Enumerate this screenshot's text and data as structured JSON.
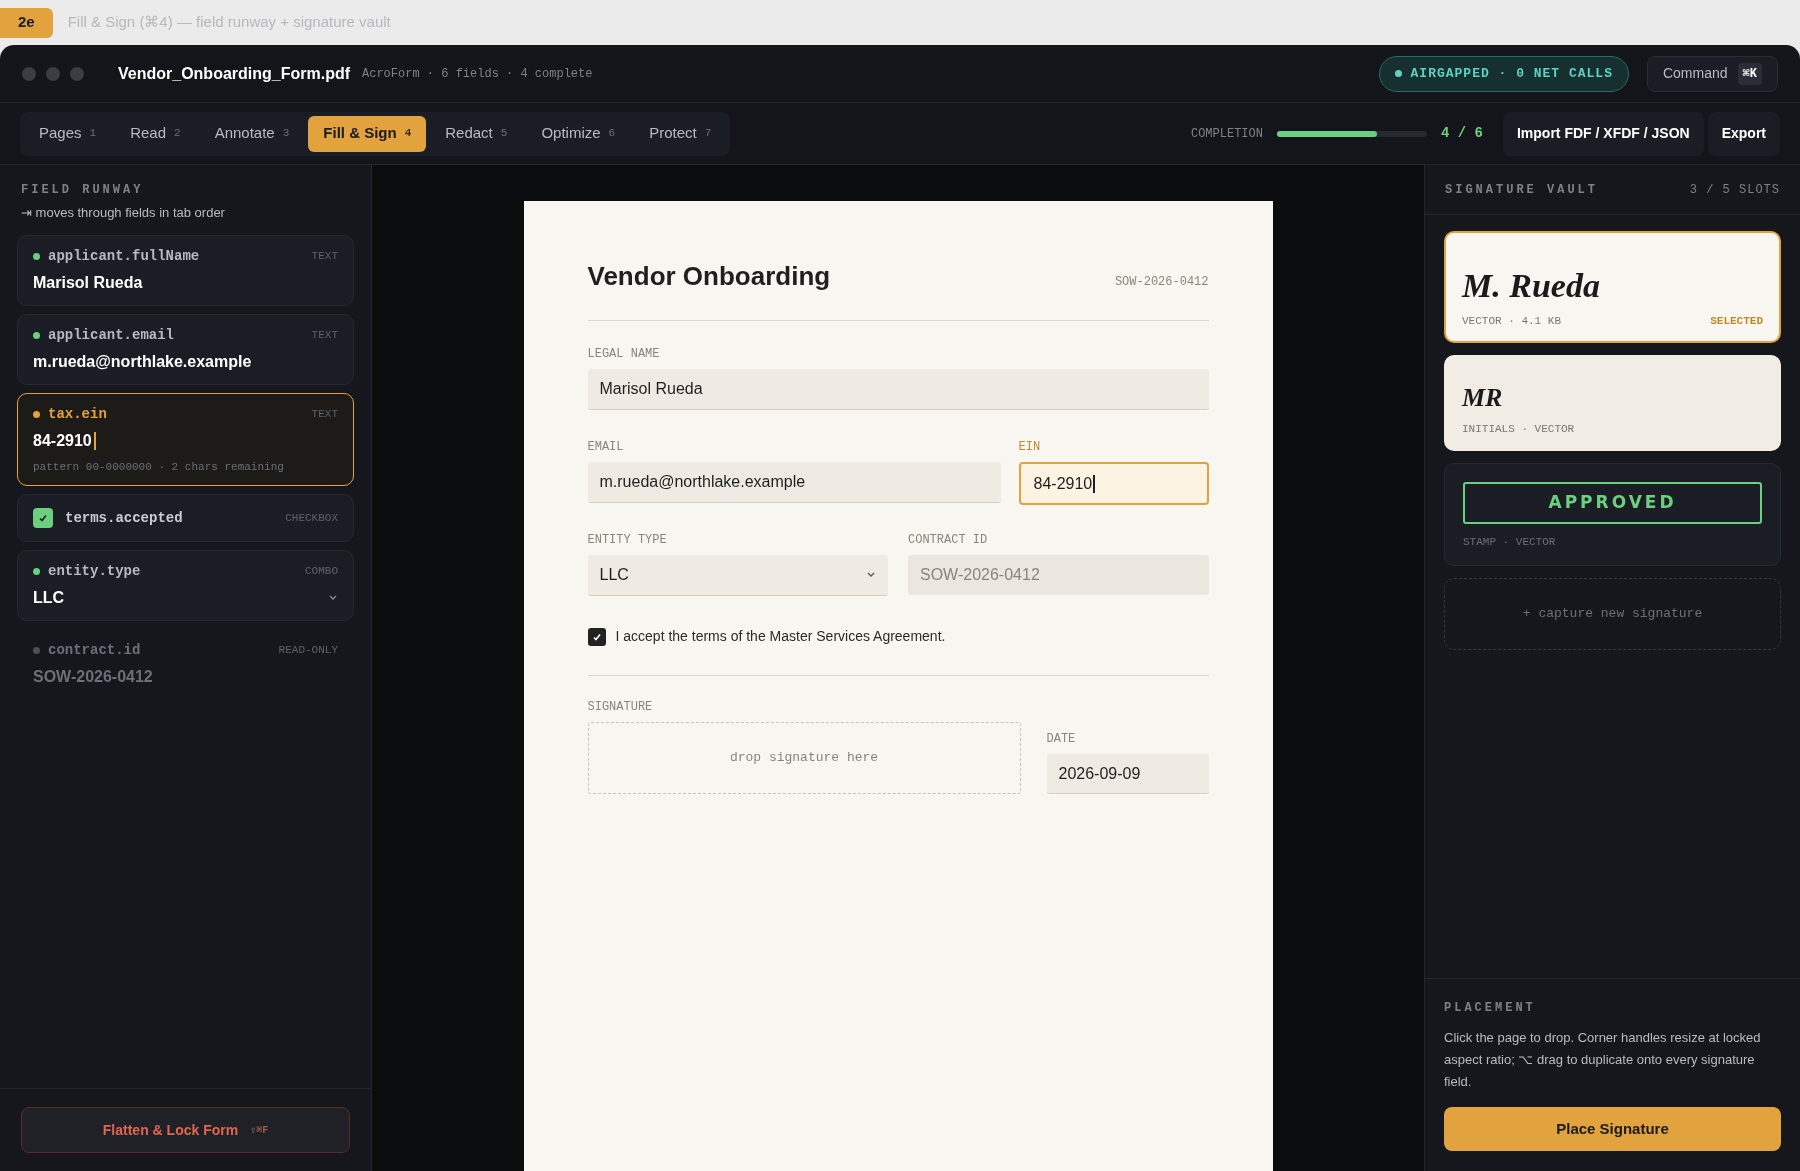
{
  "header": {
    "badge": "2e",
    "caption": "Fill & Sign (⌘4) — field runway + signature vault"
  },
  "window": {
    "filename": "Vendor_Onboarding_Form.pdf",
    "meta": "AcroForm · 6 fields · 4 complete",
    "status": "AIRGAPPED · 0 NET CALLS",
    "command": {
      "label": "Command",
      "shortcut": "⌘K"
    }
  },
  "tabs": [
    {
      "label": "Pages",
      "key": "1",
      "selected": false
    },
    {
      "label": "Read",
      "key": "2",
      "selected": false
    },
    {
      "label": "Annotate",
      "key": "3",
      "selected": false
    },
    {
      "label": "Fill & Sign",
      "key": "4",
      "selected": true
    },
    {
      "label": "Redact",
      "key": "5",
      "selected": false
    },
    {
      "label": "Optimize",
      "key": "6",
      "selected": false
    },
    {
      "label": "Protect",
      "key": "7",
      "selected": false
    }
  ],
  "completion": {
    "label": "COMPLETION",
    "level": 0.667,
    "reading": "4 / 6"
  },
  "actions": [
    "Import FDF / XFDF / JSON",
    "Export"
  ],
  "runway": {
    "title": "FIELD RUNWAY",
    "hint": "⇥ moves through fields in tab order",
    "fields": [
      {
        "kind": "text",
        "name": "applicant.fullName",
        "type": "TEXT",
        "value": "Marisol Rueda",
        "color": "#6ccf7f",
        "selected": false
      },
      {
        "kind": "text",
        "name": "applicant.email",
        "type": "TEXT",
        "value": "m.rueda@northlake.example",
        "color": "#6ccf7f",
        "selected": false
      },
      {
        "kind": "text",
        "name": "tax.ein",
        "type": "TEXT",
        "value": "84-2910",
        "color": "#e2a23e",
        "selected": true,
        "hint": "pattern 00-0000000 · 2 chars remaining"
      },
      {
        "kind": "checkbox",
        "name": "terms.accepted",
        "type": "CHECKBOX",
        "checked": true,
        "selected": false
      },
      {
        "kind": "combo",
        "name": "entity.type",
        "type": "COMBO",
        "value": "LLC",
        "color": "#6ccf7f",
        "selected": false
      },
      {
        "kind": "readonly",
        "name": "contract.id",
        "type": "READ-ONLY",
        "value": "SOW-2026-0412",
        "color": "#4b5058",
        "selected": false
      }
    ],
    "flatten": {
      "label": "Flatten & Lock Form",
      "shortcut": "⇧⌘F"
    }
  },
  "document": {
    "title": "Vendor Onboarding",
    "ref": "SOW-2026-0412",
    "legal_name": {
      "label": "LEGAL NAME",
      "value": "Marisol Rueda"
    },
    "email": {
      "label": "EMAIL",
      "value": "m.rueda@northlake.example"
    },
    "ein": {
      "label": "EIN",
      "value": "84-2910",
      "focused": true
    },
    "entity_type": {
      "label": "ENTITY TYPE",
      "value": "LLC"
    },
    "contract_id": {
      "label": "CONTRACT ID",
      "value": "SOW-2026-0412",
      "disabled": true
    },
    "terms": {
      "label": "I accept the terms of the Master Services Agreement.",
      "checked": true
    },
    "signature": {
      "label": "SIGNATURE",
      "placeholder": "drop signature here"
    },
    "date": {
      "label": "DATE",
      "value": "2026-09-09"
    }
  },
  "vault": {
    "title": "SIGNATURE VAULT",
    "slots": "3 / 5 SLOTS",
    "items": [
      {
        "kind": "signature",
        "mark": "M. Rueda",
        "meta": "VECTOR · 4.1 KB",
        "badge": "SELECTED",
        "selected": true
      },
      {
        "kind": "initials",
        "mark": "MR",
        "meta": "INITIALS · VECTOR",
        "selected": false
      },
      {
        "kind": "stamp",
        "mark": "APPROVED",
        "meta": "STAMP · VECTOR",
        "selected": false
      }
    ],
    "capture": "+ capture new signature"
  },
  "placement": {
    "title": "PLACEMENT",
    "text": "Click the page to drop. Corner handles resize at locked aspect ratio; ⌥ drag to duplicate onto every signature field.",
    "button": "Place Signature"
  }
}
